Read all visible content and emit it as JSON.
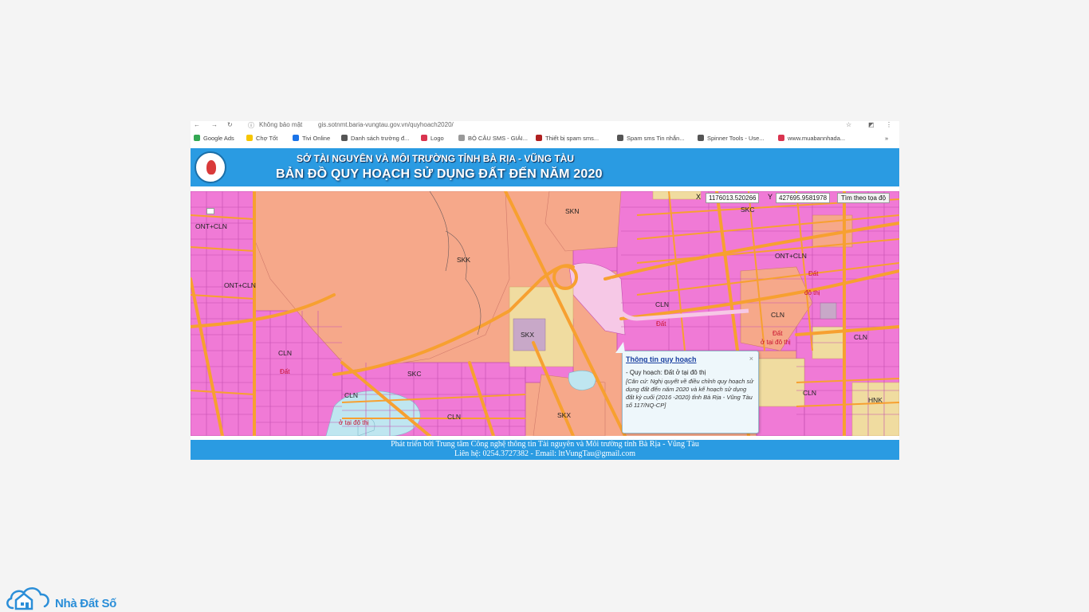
{
  "browser": {
    "security_label": "Không bảo mật",
    "url": "gis.sotnmt.baria-vungtau.gov.vn/quyhoach2020/",
    "bookmarks": [
      {
        "label": "Google Ads",
        "color": "#34a853"
      },
      {
        "label": "Chợ Tốt",
        "color": "#f7c600"
      },
      {
        "label": "Tivi Online",
        "color": "#1a73e8"
      },
      {
        "label": "Danh sách trường đ...",
        "color": "#555555"
      },
      {
        "label": "Logo",
        "color": "#d9344f"
      },
      {
        "label": "BỘ CÂU SMS - GIẢI...",
        "color": "#999999"
      },
      {
        "label": "Thiết bị spam sms...",
        "color": "#b02020"
      },
      {
        "label": "Spam sms Tin nhắn...",
        "color": "#555555"
      },
      {
        "label": "Spinner Tools - Use...",
        "color": "#555555"
      },
      {
        "label": "www.muabannhada...",
        "color": "#d9344f"
      }
    ],
    "overflow_label": "»"
  },
  "header": {
    "org_name": "SỞ TÀI NGUYÊN VÀ MÔI TRƯỜNG TỈNH BÀ RỊA - VŨNG TÀU",
    "map_title": "BẢN ĐỒ QUY HOẠCH SỬ DỤNG ĐẤT ĐẾN NĂM 2020"
  },
  "coords": {
    "x_label": "X",
    "x_value": "1176013.520266",
    "y_label": "Y",
    "y_value": "427695.9581978",
    "search_button": "Tìm theo tọa độ"
  },
  "zone_labels": [
    {
      "text": "ONT+CLN"
    },
    {
      "text": "ONT+CLN"
    },
    {
      "text": "SKK"
    },
    {
      "text": "SKN"
    },
    {
      "text": "SKC"
    },
    {
      "text": "ONT+CLN"
    },
    {
      "text": "CLN"
    },
    {
      "text": "CLN"
    },
    {
      "text": "CLN"
    },
    {
      "text": "SKX"
    },
    {
      "text": "SKC"
    },
    {
      "text": "CLN"
    },
    {
      "text": "CLN"
    },
    {
      "text": "SKX"
    },
    {
      "text": "CLN"
    },
    {
      "text": "CLN"
    },
    {
      "text": "HNK"
    }
  ],
  "red_labels": [
    {
      "text": "Đất"
    },
    {
      "text": "đô thị"
    },
    {
      "text": "Đất"
    },
    {
      "text": "Đất"
    },
    {
      "text": "ở tại đô thị"
    },
    {
      "text": "Đất"
    },
    {
      "text": "ở tại đô thị"
    }
  ],
  "popup": {
    "title": "Thông tin quy hoạch",
    "close": "×",
    "plan": "- Quy hoạch: Đất ở tại đô thị",
    "basis": "[Căn cứ: Nghị quyết về điều chỉnh quy hoạch sử dụng đất đến năm 2020 và kế hoạch sử dụng đất kỳ cuối (2016 -2020) tỉnh Bà Rịa - Vũng Tàu số 117/NQ-CP]"
  },
  "footer": {
    "line1": "Phát triển bởi Trung tâm Công nghệ thông tin Tài nguyên và Môi trường tỉnh Bà Rịa - Vũng Tàu",
    "line2": "Liên hệ: 0254.3727382 - Email: lttVungTau@gmail.com"
  },
  "brand": {
    "name": "Nhà Đất Số",
    "color": "#2a8ed8"
  },
  "colors": {
    "banner": "#2a9be2",
    "residential_pink": "#f07ad6",
    "industrial_salmon": "#f6a88a",
    "road_orange": "#f7a030",
    "water": "#bfe6f0"
  }
}
